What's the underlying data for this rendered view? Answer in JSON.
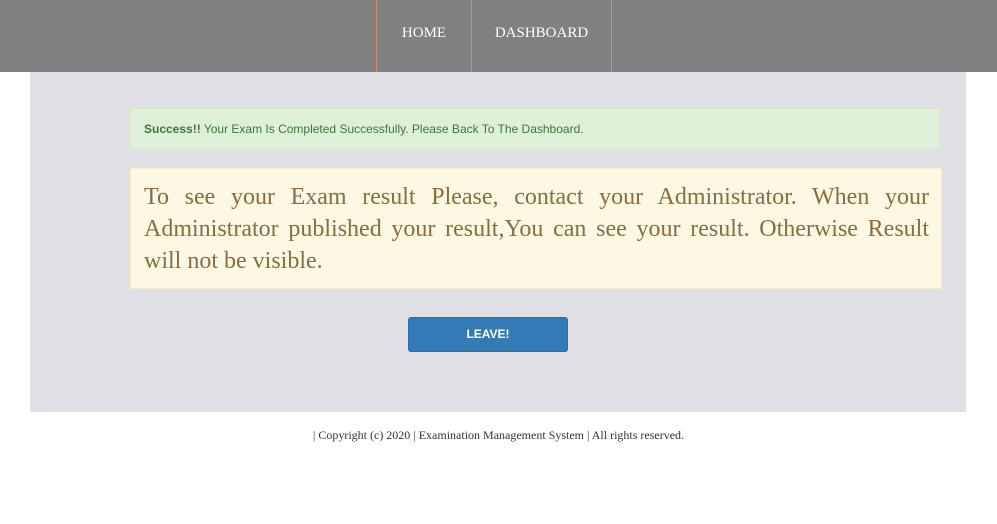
{
  "nav": {
    "home_label": "HOME",
    "dashboard_label": "DASHBOARD"
  },
  "alert_success": {
    "strong": "Success!!",
    "message": " Your Exam Is Completed Successfully. Please Back To The Dashboard."
  },
  "alert_warning": {
    "message": "To see your Exam result Please, contact your Administrator. When your Administrator published your result,You can see your result. Otherwise Result will not be visible."
  },
  "actions": {
    "leave_label": "LEAVE!"
  },
  "footer": {
    "text": "| Copyright (c) 2020 | Examination Management System | All rights reserved."
  },
  "colors": {
    "navbar": "#808080",
    "nav_divider": "#d98c6e",
    "panel": "#e0dfe6",
    "success_bg": "#dff0d8",
    "success_text": "#3c763d",
    "warning_bg": "#fcf8e3",
    "warning_text": "#8a6d3b",
    "button": "#337ab7"
  }
}
